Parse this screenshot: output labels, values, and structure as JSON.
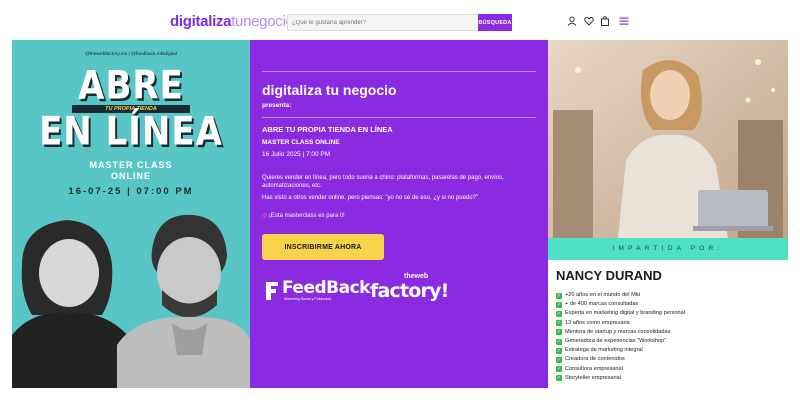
{
  "header": {
    "logo_part1": "digitaliza",
    "logo_part2": "tunegocio",
    "search_placeholder": "¿Que te gustaría aprender?",
    "search_button": "BÚSQUEDA",
    "icons": [
      "user-icon",
      "heart-icon",
      "bag-icon",
      "menu-icon"
    ],
    "accent": "#8a2be2"
  },
  "left_panel": {
    "social_handles": "@thewebfactory.mx   |   @feedback.mktdigital",
    "title_line1": "ABRE",
    "tagline": "TU PROPIA TIENDA",
    "title_line2": "EN LÍNEA",
    "class_line1": "MASTER CLASS",
    "class_line2": "ONLINE",
    "date_time": "16-07-25 | 07:00 PM",
    "bg_color": "#58c6c6"
  },
  "middle_panel": {
    "brand": "digitaliza tu negocio",
    "presenta": "presenta:",
    "heading": "ABRE TU PROPIA TIENDA EN LÍNEA",
    "subheading": "MASTER CLASS ONLINE",
    "date": "16 Julio 2025 | 7:00 PM",
    "paragraph1": "Quieres vender en línea, pero todo suena a chino: plataformas, pasarelas de pago, envíos, automatizaciones, etc.",
    "paragraph2": "Has visto a otros vender online, pero piensas: \"yo no sé de eso, ¿y si no puedo?\"",
    "paragraph3": "¡Esta masterclass es para ti!",
    "cta_label": "INSCRIBIRME AHORA",
    "logo_feedback": "FeedBack",
    "logo_feedback_sub": "Marketing Social y Publicidad",
    "logo_webfactory_top": "theweb",
    "logo_webfactory_main": "factory!",
    "bg_color": "#8a2be2",
    "cta_color": "#f6d34a"
  },
  "right_panel": {
    "impartida": "IMPARTIDA POR:",
    "speaker_name": "NANCY DURAND",
    "bullets": [
      "+20 años en el mundo del Mkt",
      "+ de 400 marcas consultadas",
      "Experta en marketing digital y branding personal",
      "13 años como empresaria",
      "Mentora de startup y marcas consolidadas",
      "Generadora de experiencias \"Workshop\"",
      "Estratega de marketing integral",
      "Creadora de contenidos",
      "Consultora empresarial",
      "Storyteller empresarial"
    ],
    "band_color": "#4de0c3",
    "check_color": "#3fb650"
  }
}
